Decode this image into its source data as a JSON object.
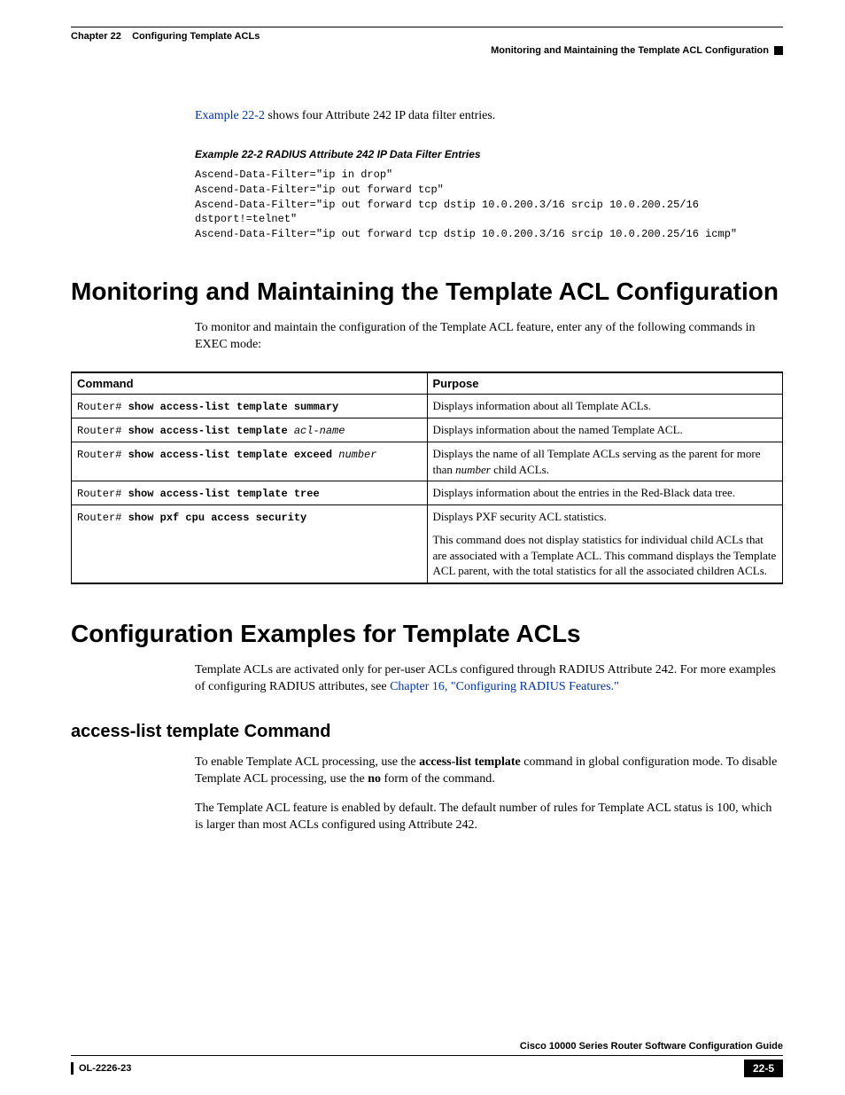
{
  "header": {
    "chapter": "Chapter 22",
    "chapter_title": "Configuring Template ACLs",
    "section": "Monitoring and Maintaining the Template ACL Configuration"
  },
  "intro_sentence_link": "Example 22-2",
  "intro_sentence_rest": " shows four Attribute 242 IP data filter entries.",
  "example_heading": "Example 22-2   RADIUS Attribute 242 IP Data Filter Entries",
  "code_block": "Ascend-Data-Filter=\"ip in drop\"\nAscend-Data-Filter=\"ip out forward tcp\"\nAscend-Data-Filter=\"ip out forward tcp dstip 10.0.200.3/16 srcip 10.0.200.25/16 dstport!=telnet\"\nAscend-Data-Filter=\"ip out forward tcp dstip 10.0.200.3/16 srcip 10.0.200.25/16 icmp\"",
  "section1": {
    "title": "Monitoring and Maintaining the Template ACL Configuration",
    "intro": "To monitor and maintain the configuration of the Template ACL feature, enter any of the following commands in EXEC mode:"
  },
  "table": {
    "headers": {
      "command": "Command",
      "purpose": "Purpose"
    },
    "rows": [
      {
        "prefix": "Router# ",
        "cmd": "show access-list template summary",
        "arg": "",
        "purpose": "Displays information about all Template ACLs."
      },
      {
        "prefix": "Router# ",
        "cmd": "show access-list template ",
        "arg": "acl-name",
        "purpose": "Displays information about the named Template ACL."
      },
      {
        "prefix": "Router# ",
        "cmd": "show access-list template exceed ",
        "arg": "number",
        "purpose_pre": "Displays the name of all Template ACLs serving as the parent for more than ",
        "purpose_arg": "number",
        "purpose_post": " child ACLs."
      },
      {
        "prefix": "Router# ",
        "cmd": "show access-list template tree",
        "arg": "",
        "purpose": "Displays information about the entries in the Red-Black data tree."
      },
      {
        "prefix": "Router# ",
        "cmd": "show pxf cpu access security",
        "arg": "",
        "purpose1": "Displays PXF security ACL statistics.",
        "purpose2": "This command does not display statistics for individual child ACLs that are associated with a Template ACL. This command displays the Template ACL parent, with the total statistics for all the associated children ACLs."
      }
    ]
  },
  "section2": {
    "title": "Configuration Examples for Template ACLs",
    "intro_pre": "Template ACLs are activated only for per-user ACLs configured through RADIUS Attribute 242. For more examples of configuring RADIUS attributes, see ",
    "intro_link": "Chapter 16, \"Configuring RADIUS Features.\""
  },
  "section3": {
    "title": "access-list template Command",
    "para1_pre": "To enable Template ACL processing, use the ",
    "para1_bold1": "access-list template",
    "para1_mid": " command in global configuration mode. To disable Template ACL processing, use the ",
    "para1_bold2": "no",
    "para1_post": " form of the command.",
    "para2": "The Template ACL feature is enabled by default. The default number of rules for Template ACL status is 100, which is larger than most ACLs configured using Attribute 242."
  },
  "footer": {
    "guide": "Cisco 10000 Series Router Software Configuration Guide",
    "doc_id": "OL-2226-23",
    "page": "22-5"
  }
}
